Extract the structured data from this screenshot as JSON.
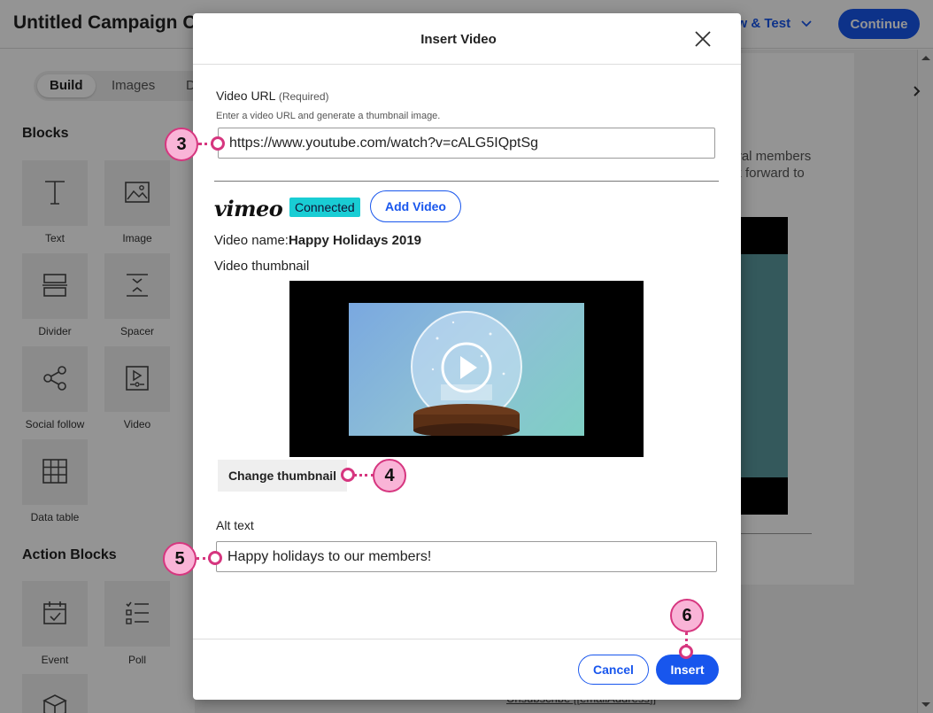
{
  "app": {
    "title": "Untitled Campaign Cr",
    "preview_link": "iew & Test",
    "continue_label": "Continue"
  },
  "left_panel": {
    "tabs": [
      "Build",
      "Images",
      "D"
    ],
    "blocks_heading": "Blocks",
    "blocks": [
      {
        "label": "Text",
        "icon": "text-icon"
      },
      {
        "label": "Image",
        "icon": "image-icon"
      },
      {
        "label": "Divider",
        "icon": "divider-icon"
      },
      {
        "label": "Spacer",
        "icon": "spacer-icon"
      },
      {
        "label": "Social follow",
        "icon": "share-icon"
      },
      {
        "label": "Video",
        "icon": "video-icon"
      },
      {
        "label": "Data table",
        "icon": "table-icon"
      }
    ],
    "action_heading": "Action Blocks",
    "action_blocks": [
      {
        "label": "Event",
        "icon": "calendar-icon"
      },
      {
        "label": "Poll",
        "icon": "poll-icon"
      }
    ]
  },
  "background": {
    "text_line1": "oyal members",
    "text_line2": "ok forward to",
    "footer": "Unsubscribe [[emailAddress]]"
  },
  "modal": {
    "title": "Insert Video",
    "url_label": "Video URL",
    "url_required": "(Required)",
    "url_help": "Enter a video URL and generate a thumbnail image.",
    "url_value": "https://www.youtube.com/watch?v=cALG5IQptSg",
    "provider": "vimeo",
    "connected_badge": "Connected",
    "add_video_label": "Add Video",
    "video_name_label": "Video name:",
    "video_name_value": "Happy Holidays 2019",
    "thumbnail_label": "Video thumbnail",
    "change_thumbnail_label": "Change thumbnail",
    "alt_label": "Alt text",
    "alt_value": "Happy holidays to our members!",
    "cancel_label": "Cancel",
    "insert_label": "Insert"
  },
  "callouts": [
    "3",
    "4",
    "5",
    "6"
  ],
  "colors": {
    "accent": "#1856ed",
    "callout_fill": "#f9b4d7",
    "callout_stroke": "#d6367f",
    "connected": "#19cdd4"
  }
}
